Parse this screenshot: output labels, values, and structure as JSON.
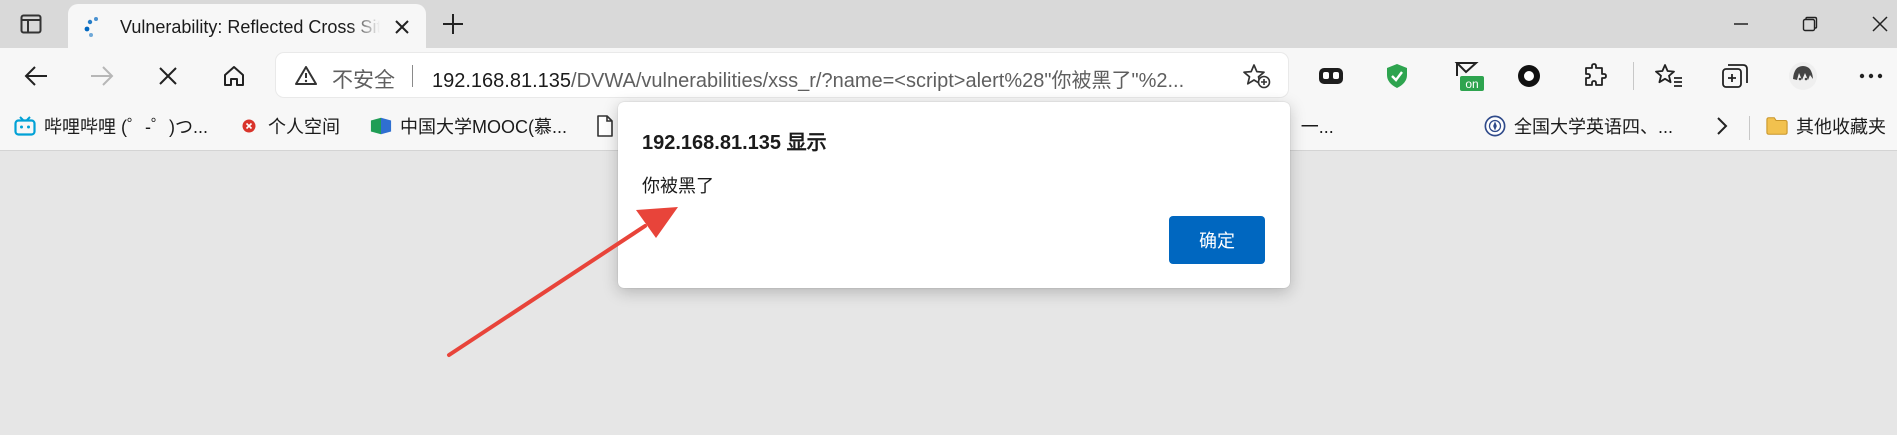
{
  "tab": {
    "title": "Vulnerability: Reflected Cross Site Scripting (XSS)"
  },
  "address_bar": {
    "security_label": "不安全",
    "url_host": "192.168.81.135",
    "url_path": "/DVWA/vulnerabilities/xss_r/?name=<script>alert%28\"你被黑了\"%2..."
  },
  "extensions": {
    "on_badge": "on"
  },
  "bookmarks": [
    {
      "label": "哔哩哔哩 (゜-゜)つ...",
      "icon": "bilibili-icon"
    },
    {
      "label": "个人空间",
      "icon": "red-circle-icon"
    },
    {
      "label": "中国大学MOOC(慕...",
      "icon": "mooc-icon"
    },
    {
      "label": "Font Awesome，一...",
      "icon": "page-icon"
    },
    {
      "label": "全国大学英语四、...",
      "icon": "cet-seal-icon"
    }
  ],
  "other_bookmarks": {
    "label": "其他收藏夹"
  },
  "alert": {
    "title": "192.168.81.135 显示",
    "message": "你被黑了",
    "ok_label": "确定"
  },
  "colors": {
    "primary_button": "#0067c0",
    "annotation_arrow": "#e8443a",
    "page_background": "#e6e6e6",
    "shield_green": "#2ea44f"
  }
}
